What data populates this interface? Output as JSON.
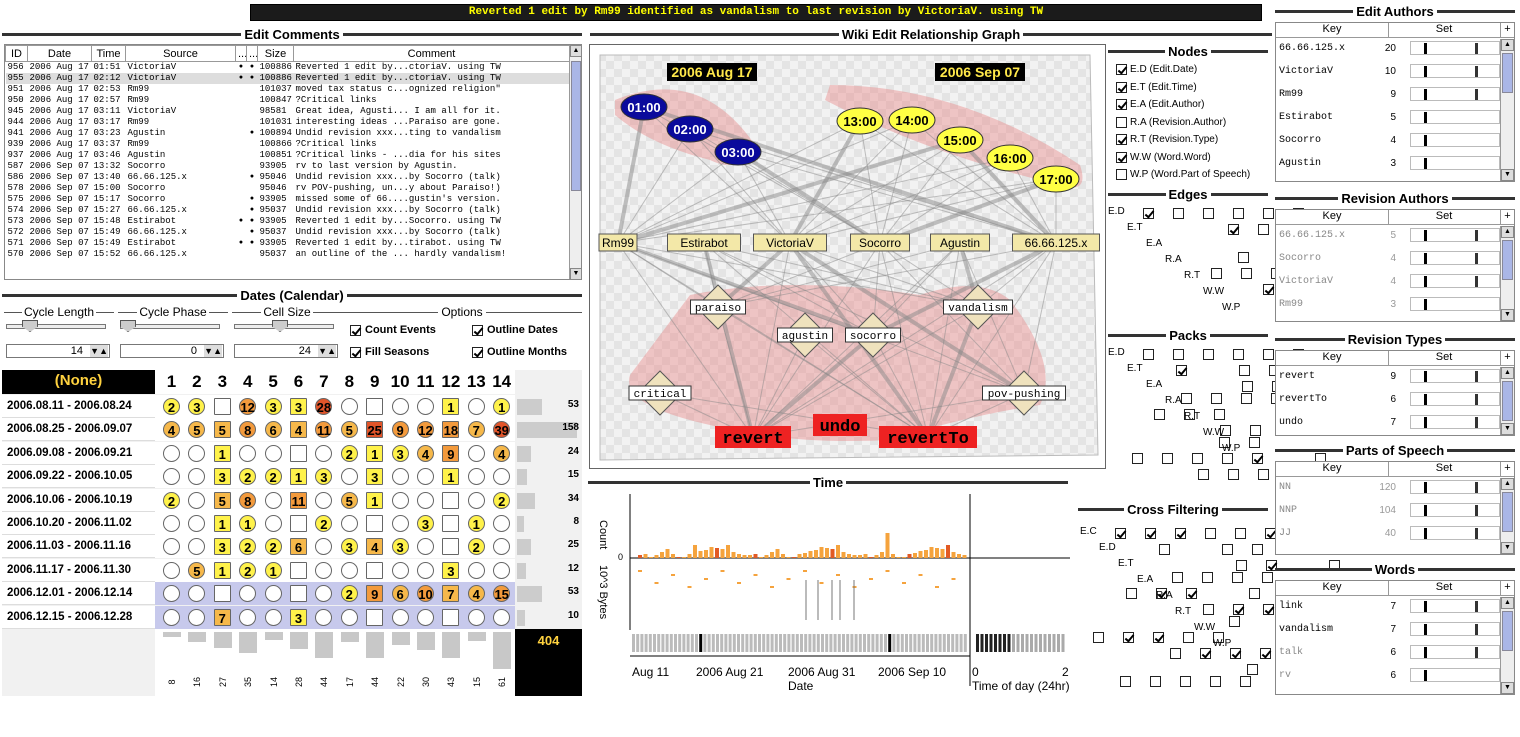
{
  "banner": "Reverted 1 edit by Rm99 identified as vandalism to last revision by VictoriaV. using TW",
  "sections": {
    "edit_comments": "Edit Comments",
    "graph": "Wiki Edit Relationship Graph",
    "dates": "Dates (Calendar)",
    "time": "Time",
    "nodes": "Nodes",
    "edges": "Edges",
    "packs": "Packs",
    "cross": "Cross Filtering",
    "edit_authors": "Edit Authors",
    "revision_authors": "Revision Authors",
    "revision_types": "Revision Types",
    "parts_of_speech": "Parts of Speech",
    "words": "Words"
  },
  "edits": {
    "headers": [
      "ID",
      "Date",
      "Time",
      "Source",
      "...",
      "...",
      "Size",
      "Comment",
      "+"
    ],
    "rows": [
      [
        "956",
        "2006 Aug 17",
        "01:51",
        "VictoriaV",
        "●",
        "●",
        "100886",
        "Reverted 1 edit by...ctoriaV. using TW"
      ],
      [
        "955",
        "2006 Aug 17",
        "02:12",
        "VictoriaV",
        "●",
        "●",
        "100886",
        "Reverted 1 edit by...ctoriaV. using TW"
      ],
      [
        "951",
        "2006 Aug 17",
        "02:53",
        "Rm99",
        "",
        "",
        "101037",
        "moved tax status c...ognized religion\""
      ],
      [
        "950",
        "2006 Aug 17",
        "02:57",
        "Rm99",
        "",
        "",
        "100847",
        "?Critical links"
      ],
      [
        "945",
        "2006 Aug 17",
        "03:11",
        "VictoriaV",
        "",
        "",
        "98581",
        "Great idea, Agusti... I am all for it."
      ],
      [
        "944",
        "2006 Aug 17",
        "03:17",
        "Rm99",
        "",
        "",
        "101031",
        "interesting ideas ...Paraiso are gone."
      ],
      [
        "941",
        "2006 Aug 17",
        "03:23",
        "Agustin",
        "",
        "●",
        "100894",
        "Undid revision xxx...ting to vandalism"
      ],
      [
        "939",
        "2006 Aug 17",
        "03:37",
        "Rm99",
        "",
        "",
        "100866",
        "?Critical links"
      ],
      [
        "937",
        "2006 Aug 17",
        "03:46",
        "Agustin",
        "",
        "",
        "100851",
        "?Critical links - ...dia for his sites"
      ],
      [
        "587",
        "2006 Sep 07",
        "13:32",
        "Socorro",
        "",
        "",
        "93905",
        "rv to last version by Agustin."
      ],
      [
        "586",
        "2006 Sep 07",
        "13:40",
        "66.66.125.x",
        "",
        "●",
        "95046",
        "Undid revision xxx...by Socorro (talk)"
      ],
      [
        "578",
        "2006 Sep 07",
        "15:00",
        "Socorro",
        "",
        "",
        "95046",
        "rv POV-pushing, un...y about Paraiso!)"
      ],
      [
        "575",
        "2006 Sep 07",
        "15:17",
        "Socorro",
        "",
        "●",
        "93905",
        "missed some of 66....gustin's version."
      ],
      [
        "574",
        "2006 Sep 07",
        "15:27",
        "66.66.125.x",
        "",
        "●",
        "95037",
        "Undid revision xxx...by Socorro (talk)"
      ],
      [
        "573",
        "2006 Sep 07",
        "15:48",
        "Estirabot",
        "●",
        "●",
        "93905",
        "Reverted 1 edit by...Socorro. using TW"
      ],
      [
        "572",
        "2006 Sep 07",
        "15:49",
        "66.66.125.x",
        "",
        "●",
        "95037",
        "Undid revision xxx...by Socorro (talk)"
      ],
      [
        "571",
        "2006 Sep 07",
        "15:49",
        "Estirabot",
        "●",
        "●",
        "93905",
        "Reverted 1 edit by...tirabot. using TW"
      ],
      [
        "570",
        "2006 Sep 07",
        "15:52",
        "66.66.125.x",
        "",
        "",
        "95037",
        "an outline of the ... hardly vandalism!"
      ]
    ]
  },
  "calendar": {
    "sliders": [
      {
        "label": "Cycle Length",
        "value": "14"
      },
      {
        "label": "Cycle Phase",
        "value": "0"
      },
      {
        "label": "Cell Size",
        "value": "24"
      }
    ],
    "options_label": "Options",
    "options": [
      {
        "label": "Count Events",
        "on": true
      },
      {
        "label": "Outline Dates",
        "on": true
      },
      {
        "label": "Fill Seasons",
        "on": true
      },
      {
        "label": "Outline Months",
        "on": true
      }
    ],
    "corner": "(None)",
    "columns": [
      "1",
      "2",
      "3",
      "4",
      "5",
      "6",
      "7",
      "8",
      "9",
      "10",
      "11",
      "12",
      "13",
      "14"
    ],
    "rows": [
      {
        "label": "2006.08.11 - 2006.08.24",
        "total": "53",
        "cells": [
          "2",
          "3",
          "",
          "12",
          "3",
          "3",
          "28",
          "",
          "",
          "",
          "",
          "1",
          "",
          "1"
        ]
      },
      {
        "label": "2006.08.25 - 2006.09.07",
        "total": "158",
        "cells": [
          "4",
          "5",
          "5",
          "8",
          "6",
          "4",
          "11",
          "5",
          "25",
          "9",
          "12",
          "18",
          "7",
          "39"
        ]
      },
      {
        "label": "2006.09.08 - 2006.09.21",
        "total": "24",
        "cells": [
          "",
          "",
          "1",
          "",
          "",
          "",
          "",
          "2",
          "1",
          "3",
          "4",
          "9",
          "",
          "4"
        ]
      },
      {
        "label": "2006.09.22 - 2006.10.05",
        "total": "15",
        "cells": [
          "",
          "",
          "3",
          "2",
          "2",
          "1",
          "3",
          "",
          "3",
          "",
          "",
          "1",
          "",
          ""
        ]
      },
      {
        "label": "2006.10.06 - 2006.10.19",
        "total": "34",
        "cells": [
          "2",
          "",
          "5",
          "8",
          "",
          "11",
          "",
          "5",
          "1",
          "",
          "",
          "",
          "",
          "2"
        ]
      },
      {
        "label": "2006.10.20 - 2006.11.02",
        "total": "8",
        "cells": [
          "",
          "",
          "1",
          "1",
          "",
          "",
          "2",
          "",
          "",
          "",
          "3",
          "",
          "1",
          ""
        ]
      },
      {
        "label": "2006.11.03 - 2006.11.16",
        "total": "25",
        "cells": [
          "",
          "",
          "3",
          "2",
          "2",
          "6",
          "",
          "3",
          "4",
          "3",
          "",
          "",
          "2",
          ""
        ]
      },
      {
        "label": "2006.11.17 - 2006.11.30",
        "total": "12",
        "cells": [
          "",
          "5",
          "1",
          "2",
          "1",
          "",
          "",
          "",
          "",
          "",
          "",
          "3",
          "",
          ""
        ]
      },
      {
        "label": "2006.12.01 - 2006.12.14",
        "total": "53",
        "cells": [
          "",
          "",
          "",
          "",
          "",
          "",
          "",
          "2",
          "9",
          "6",
          "10",
          "7",
          "4",
          "15"
        ]
      },
      {
        "label": "2006.12.15 - 2006.12.28",
        "total": "10",
        "cells": [
          "",
          "",
          "7",
          "",
          "",
          "3",
          "",
          "",
          "",
          "",
          "",
          "",
          "",
          ""
        ]
      }
    ],
    "col_totals": [
      "8",
      "16",
      "27",
      "35",
      "14",
      "28",
      "44",
      "17",
      "44",
      "22",
      "30",
      "43",
      "15",
      "61"
    ],
    "grand_total": "404"
  },
  "graph": {
    "dates": [
      "2006 Aug 17",
      "2006 Sep 07"
    ],
    "times": [
      "01:00",
      "02:00",
      "03:00",
      "13:00",
      "14:00",
      "15:00",
      "16:00",
      "17:00"
    ],
    "authors": [
      "Rm99",
      "Estirabot",
      "VictoriaV",
      "Socorro",
      "Agustin",
      "66.66.125.x"
    ],
    "words": [
      "paraiso",
      "agustin",
      "socorro",
      "vandalism",
      "critical",
      "pov-pushing"
    ],
    "types": [
      "revert",
      "undo",
      "revertTo"
    ]
  },
  "nodes_panel": [
    {
      "label": "E.D (Edit.Date)",
      "on": true
    },
    {
      "label": "E.T (Edit.Time)",
      "on": true
    },
    {
      "label": "E.A (Edit.Author)",
      "on": true
    },
    {
      "label": "R.A (Revision.Author)",
      "on": false
    },
    {
      "label": "R.T (Revision.Type)",
      "on": true
    },
    {
      "label": "W.W (Word.Word)",
      "on": true
    },
    {
      "label": "W.P (Word.Part of Speech)",
      "on": false
    }
  ],
  "matrix_labels": [
    "E.D",
    "E.T",
    "E.A",
    "R.A",
    "R.T",
    "W.W",
    "W.P"
  ],
  "cross_labels": [
    "E.C",
    "E.D",
    "E.T",
    "E.A",
    "R.A",
    "R.T",
    "W.W",
    "W.P"
  ],
  "time_panel": {
    "y1": "Count",
    "y2": "10^3 Bytes",
    "y_zero": "0",
    "x_ticks": [
      "Aug 11",
      "2006 Aug 21",
      "2006 Aug 31",
      "2006 Sep 10"
    ],
    "xlabel": "Date",
    "x2_ticks": [
      "0",
      "2"
    ],
    "x2label": "Time of day (24hr)"
  },
  "edit_authors": {
    "head": [
      "Key",
      "Set",
      "+"
    ],
    "rows": [
      [
        "66.66.125.x",
        "20"
      ],
      [
        "VictoriaV",
        "10"
      ],
      [
        "Rm99",
        "9"
      ],
      [
        "Estirabot",
        "5"
      ],
      [
        "Socorro",
        "4"
      ],
      [
        "Agustin",
        "3"
      ]
    ]
  },
  "revision_authors": {
    "head": [
      "Key",
      "Set",
      "+"
    ],
    "rows": [
      [
        "66.66.125.x",
        "5"
      ],
      [
        "Socorro",
        "4"
      ],
      [
        "VictoriaV",
        "4"
      ],
      [
        "Rm99",
        "3"
      ]
    ]
  },
  "revision_types": {
    "head": [
      "Key",
      "Set",
      "+"
    ],
    "rows": [
      [
        "revert",
        "9"
      ],
      [
        "revertTo",
        "6"
      ],
      [
        "undo",
        "7"
      ]
    ]
  },
  "parts_of_speech": {
    "head": [
      "Key",
      "Set",
      "+"
    ],
    "rows": [
      [
        "NN",
        "120"
      ],
      [
        "NNP",
        "104"
      ],
      [
        "JJ",
        "40"
      ]
    ]
  },
  "words": {
    "head": [
      "Key",
      "Set",
      "+"
    ],
    "rows": [
      [
        "link",
        "7"
      ],
      [
        "vandalism",
        "7"
      ],
      [
        "talk",
        "6"
      ],
      [
        "rv",
        "6"
      ]
    ]
  },
  "colors": {
    "banner_bg": "#1b1b1b",
    "banner_fg": "#ffff00",
    "time_node": "#0a0a9c",
    "time_node2": "#ffff44",
    "author_node": "#f3e8a8",
    "type_node": "#ee2222",
    "hull": "#e98c8c"
  }
}
